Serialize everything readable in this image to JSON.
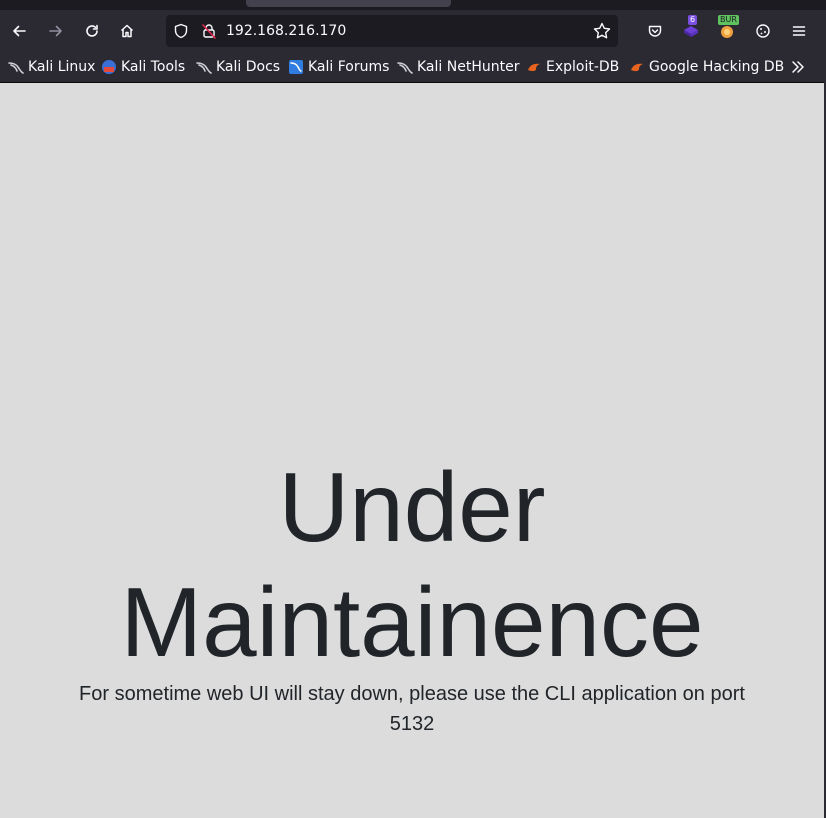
{
  "browser": {
    "url": "192.168.216.170",
    "toolbar_icons": [
      "back-arrow-icon",
      "forward-arrow-icon",
      "reload-icon",
      "home-icon",
      "shield-icon",
      "insecure-lock-icon",
      "bookmark-star-icon",
      "pocket-icon",
      "hackbar-extension-icon",
      "burp-extension-icon",
      "cookie-editor-icon",
      "hamburger-menu-icon"
    ],
    "extension_badge_count": "6",
    "burp_badge": "BUR"
  },
  "bookmarks": [
    {
      "label": "Kali Linux",
      "icon": "kali-dragon-icon"
    },
    {
      "label": "Kali Tools",
      "icon": "kali-tools-icon"
    },
    {
      "label": "Kali Docs",
      "icon": "kali-dragon-icon"
    },
    {
      "label": "Kali Forums",
      "icon": "kali-forums-icon"
    },
    {
      "label": "Kali NetHunter",
      "icon": "kali-dragon-icon"
    },
    {
      "label": "Exploit-DB",
      "icon": "exploit-db-icon"
    },
    {
      "label": "Google Hacking DB",
      "icon": "exploit-db-icon"
    }
  ],
  "page": {
    "heading": "Under Maintainence",
    "message": "For sometime web UI will stay down, please use the CLI application on port 5132"
  },
  "colors": {
    "chrome_bg": "#2b2a33",
    "urlbar_bg": "#1c1b22",
    "page_bg": "#dcdcdc",
    "text_dark": "#212529"
  }
}
